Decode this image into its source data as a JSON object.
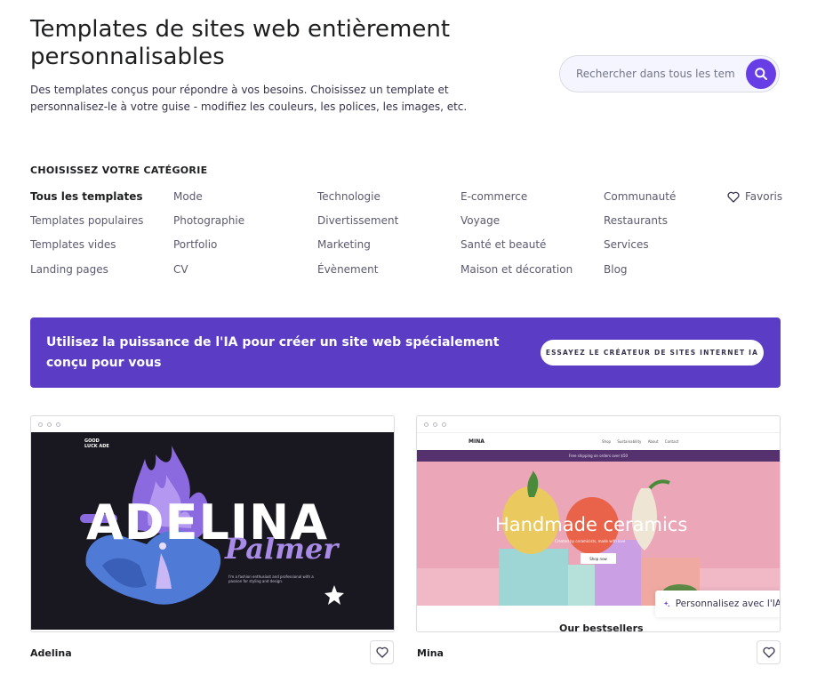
{
  "header": {
    "title": "Templates de sites web entièrement personnalisables",
    "description": "Des templates conçus pour répondre à vos besoins. Choisissez un template et personnalisez-le à votre guise - modifiez les couleurs, les polices, les images, etc."
  },
  "search": {
    "placeholder": "Rechercher dans tous les tem",
    "icon": "search-icon"
  },
  "categories": {
    "heading": "CHOISISSEZ VOTRE CATÉGORIE",
    "columns": [
      [
        "Tous les templates",
        "Templates populaires",
        "Templates vides",
        "Landing pages"
      ],
      [
        "Mode",
        "Photographie",
        "Portfolio",
        "CV"
      ],
      [
        "Technologie",
        "Divertissement",
        "Marketing",
        "Évènement"
      ],
      [
        "E-commerce",
        "Voyage",
        "Santé et beauté",
        "Maison et décoration"
      ],
      [
        "Communauté",
        "Restaurants",
        "Services",
        "Blog"
      ]
    ],
    "active": "Tous les templates",
    "favorites_label": "Favoris"
  },
  "ai_banner": {
    "text": "Utilisez la puissance de l'IA pour créer un site web spécialement conçu pour vous",
    "button_label": "ESSAYEZ LE CRÉATEUR DE SITES INTERNET IA",
    "background": "#5b3cc4"
  },
  "templates": [
    {
      "name": "Adelina",
      "preview": {
        "logo": "GOOD LUCK ADE",
        "headline": "ADELINA",
        "script": "Palmer",
        "blurb": "I'm a fashion enthusiast and professional with a passion for styling and design."
      }
    },
    {
      "name": "Mina",
      "preview": {
        "logo": "MINA",
        "nav": "Shop   Sustainability   About   Contact",
        "strip": "Free shipping on orders over $50",
        "headline": "Handmade ceramics",
        "sub": "Created by ceramicists, made with love",
        "shop_button": "Shop now",
        "section": "Our bestsellers",
        "ai_prompt": "Personnalisez avec l'IA"
      }
    }
  ],
  "colors": {
    "accent": "#673de6",
    "text_dark": "#1d1e20",
    "text_muted": "#5b5a6e"
  }
}
